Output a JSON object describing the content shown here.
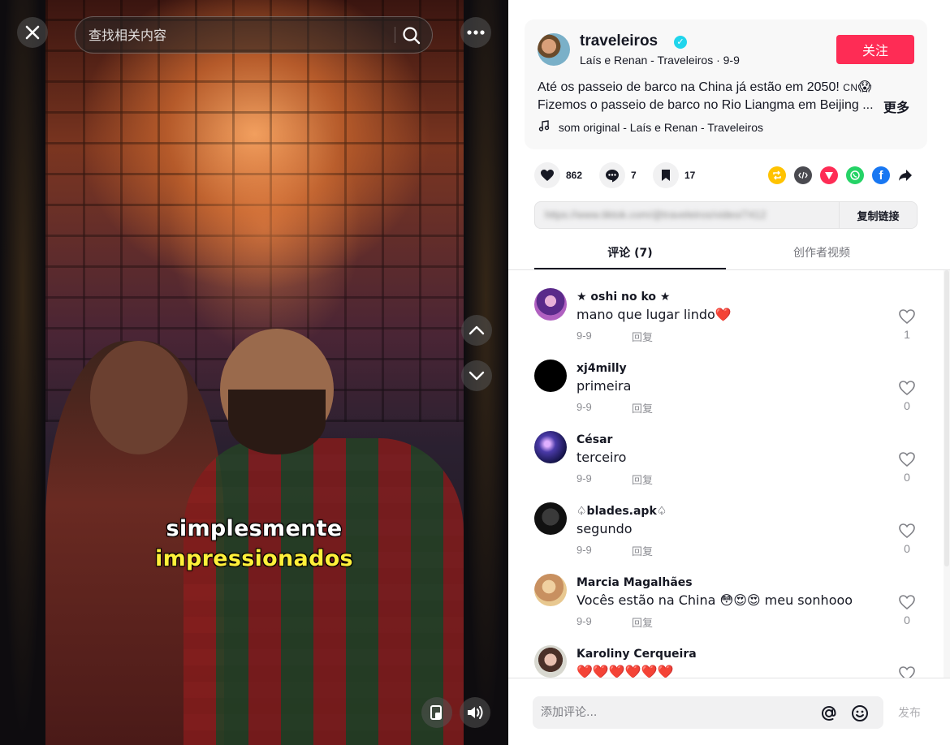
{
  "search": {
    "placeholder": "查找相关内容"
  },
  "video": {
    "caption_line1": "simplesmente",
    "caption_line2": "impressionados",
    "colors": {
      "caption_white": "#ffffff",
      "caption_yellow": "#fff03a"
    }
  },
  "icons": {
    "close": "close-icon",
    "more": "more-icon",
    "search": "search-icon",
    "up": "chevron-up-icon",
    "down": "chevron-down-icon",
    "float": "floating-player-icon",
    "volume": "volume-icon"
  },
  "author": {
    "username": "traveleiros",
    "verified_mark": "✓",
    "subline": "Laís e Renan - Traveleiros · 9-9",
    "follow_label": "关注",
    "description_part1": "Até os passeio de barco na China já estão em 2050! ",
    "description_flag": "CN",
    "description_emoji": "😱",
    "description_part2": "Fizemos o passeio de barco no Rio Liangma em Beijing ...",
    "more_label": "更多",
    "music": "som original - Laís e Renan - Traveleiros",
    "accent_color": "#fe2c55"
  },
  "actions": {
    "likes": "862",
    "comments": "7",
    "favorites": "17"
  },
  "share": {
    "icons": [
      "repost-icon",
      "embed-icon",
      "send-icon",
      "whatsapp-icon",
      "facebook-icon",
      "share-arrow-icon"
    ]
  },
  "link": {
    "text": "https://www.tiktok.com/@traveleiros/video/7412",
    "copy_label": "复制链接"
  },
  "tabs": {
    "comments_label": "评论 (7)",
    "creator_label": "创作者视频"
  },
  "comments": [
    {
      "name": "★ oshi no ko ★",
      "text": "mano que lugar lindo❤️",
      "date": "9-9",
      "reply": "回复",
      "likes": "1"
    },
    {
      "name": "xj4milly",
      "text": "primeira",
      "date": "9-9",
      "reply": "回复",
      "likes": "0"
    },
    {
      "name": "César",
      "text": "terceiro",
      "date": "9-9",
      "reply": "回复",
      "likes": "0"
    },
    {
      "name": "♤blades.apk♤",
      "text": "segundo",
      "date": "9-9",
      "reply": "回复",
      "likes": "0"
    },
    {
      "name": "Marcia Magalhães",
      "text": "Vocês estão na China 😳😍😍 meu sonhooo",
      "date": "9-9",
      "reply": "回复",
      "likes": "0"
    },
    {
      "name": "Karoliny Cerqueira",
      "text": "❤️❤️❤️❤️❤️❤️",
      "date": "",
      "reply": "",
      "likes": ""
    }
  ],
  "footer": {
    "comment_placeholder": "添加评论...",
    "post_label": "发布"
  }
}
